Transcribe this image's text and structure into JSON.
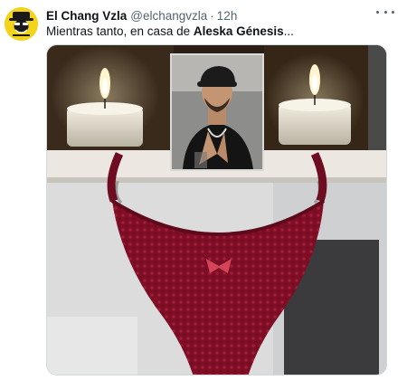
{
  "tweet": {
    "display_name": "El Chang Vzla",
    "handle": "@elchangvzla",
    "separator": "·",
    "time": "12h",
    "text_prefix": "Mientras tanto, en casa de ",
    "text_bold": "Aleska Génesis",
    "text_suffix": "..."
  },
  "colors": {
    "accent": "#1d9bf0",
    "avatar_bg": "#f4d31b",
    "secondary_text": "#536471"
  },
  "icons": {
    "more": "more-dots-icon",
    "avatar": "cartoon-man-with-hat"
  }
}
